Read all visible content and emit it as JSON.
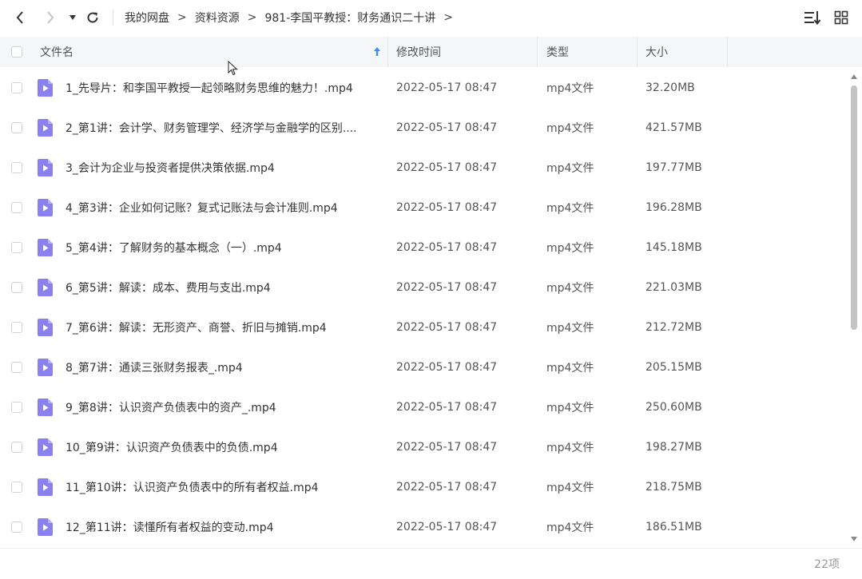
{
  "toolbar": {
    "breadcrumb": [
      "我的网盘",
      "资料资源",
      "981-李国平教授：财务通识二十讲"
    ],
    "separator": ">"
  },
  "header": {
    "name": "文件名",
    "modified": "修改时间",
    "type": "类型",
    "size": "大小"
  },
  "files": [
    {
      "name": "1_先导片：和李国平教授一起领略财务思维的魅力！.mp4",
      "date": "2022-05-17 08:47",
      "type": "mp4文件",
      "size": "32.20MB"
    },
    {
      "name": "2_第1讲：会计学、财务管理学、经济学与金融学的区别....",
      "date": "2022-05-17 08:47",
      "type": "mp4文件",
      "size": "421.57MB"
    },
    {
      "name": "3_会计为企业与投资者提供决策依据.mp4",
      "date": "2022-05-17 08:47",
      "type": "mp4文件",
      "size": "197.77MB"
    },
    {
      "name": "4_第3讲：企业如何记账？复式记账法与会计准则.mp4",
      "date": "2022-05-17 08:47",
      "type": "mp4文件",
      "size": "196.28MB"
    },
    {
      "name": "5_第4讲：了解财务的基本概念（一）.mp4",
      "date": "2022-05-17 08:47",
      "type": "mp4文件",
      "size": "145.18MB"
    },
    {
      "name": "6_第5讲：解读：成本、费用与支出.mp4",
      "date": "2022-05-17 08:47",
      "type": "mp4文件",
      "size": "221.03MB"
    },
    {
      "name": "7_第6讲：解读：无形资产、商誉、折旧与摊销.mp4",
      "date": "2022-05-17 08:47",
      "type": "mp4文件",
      "size": "212.72MB"
    },
    {
      "name": "8_第7讲：通读三张财务报表_.mp4",
      "date": "2022-05-17 08:47",
      "type": "mp4文件",
      "size": "205.15MB"
    },
    {
      "name": "9_第8讲：认识资产负债表中的资产_.mp4",
      "date": "2022-05-17 08:47",
      "type": "mp4文件",
      "size": "250.60MB"
    },
    {
      "name": "10_第9讲：认识资产负债表中的负债.mp4",
      "date": "2022-05-17 08:47",
      "type": "mp4文件",
      "size": "198.27MB"
    },
    {
      "name": "11_第10讲：认识资产负债表中的所有者权益.mp4",
      "date": "2022-05-17 08:47",
      "type": "mp4文件",
      "size": "218.75MB"
    },
    {
      "name": "12_第11讲：读懂所有者权益的变动.mp4",
      "date": "2022-05-17 08:47",
      "type": "mp4文件",
      "size": "186.51MB"
    }
  ],
  "footer": {
    "count": "22项"
  },
  "colors": {
    "file_icon": "#8a80f0",
    "sort_arrow": "#3b8cf0"
  }
}
